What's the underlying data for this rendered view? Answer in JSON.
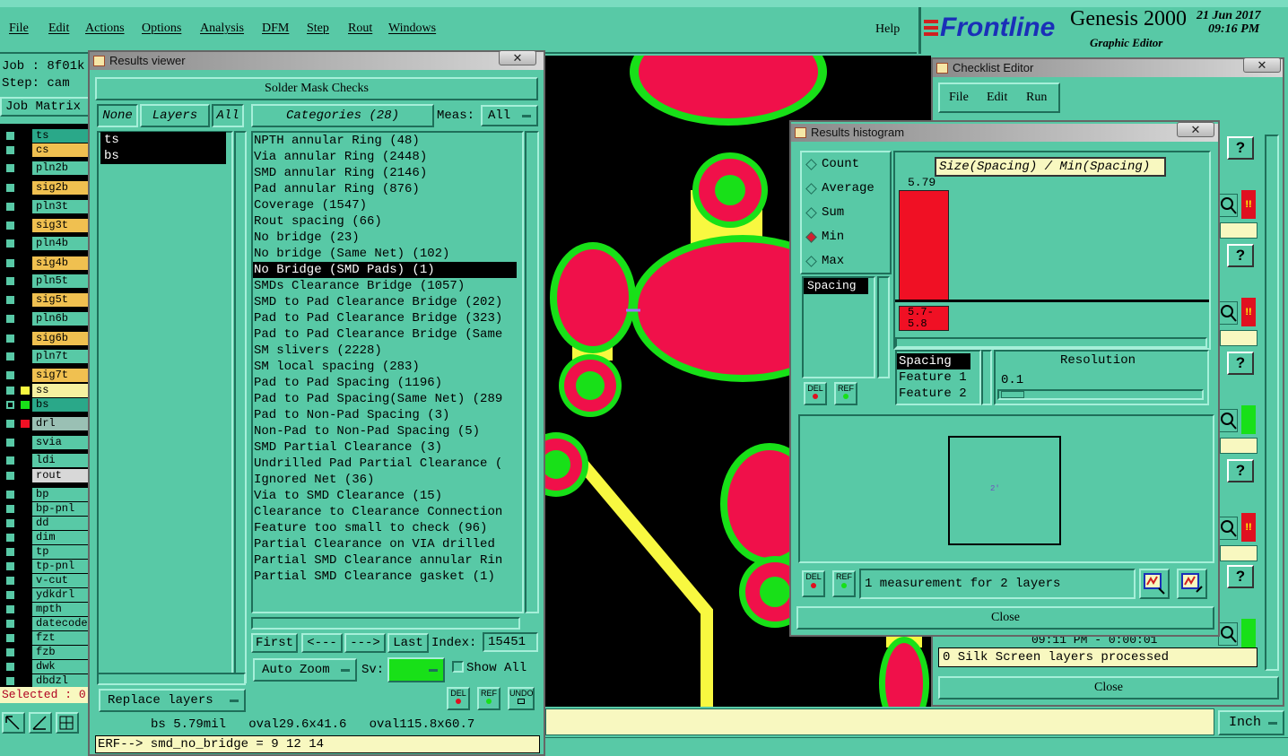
{
  "menu": [
    "File",
    "Edit",
    "Actions",
    "Options",
    "Analysis",
    "DFM",
    "Step",
    "Rout",
    "Windows"
  ],
  "help": "Help",
  "brand": {
    "logo": "Frontline",
    "product": "Genesis 2000",
    "subtitle": "Graphic Editor",
    "date": "21 Jun 2017",
    "time": "09:16 PM"
  },
  "job": {
    "job_label": "Job : 8f01k",
    "step_label": "Step: cam",
    "matrix": "Job Matrix",
    "selected": "Selected : 0"
  },
  "layers": [
    {
      "name": "ts",
      "color": "#2aa889"
    },
    {
      "name": "cs",
      "color": "#f0c050"
    },
    {
      "name": "pln2b",
      "color": "#58c9a6"
    },
    {
      "name": "sig2b",
      "color": "#f0c050"
    },
    {
      "name": "pln3t",
      "color": "#58c9a6"
    },
    {
      "name": "sig3t",
      "color": "#f0c050"
    },
    {
      "name": "pln4b",
      "color": "#58c9a6"
    },
    {
      "name": "sig4b",
      "color": "#f0c050"
    },
    {
      "name": "pln5t",
      "color": "#58c9a6"
    },
    {
      "name": "sig5t",
      "color": "#f0c050"
    },
    {
      "name": "pln6b",
      "color": "#58c9a6"
    },
    {
      "name": "sig6b",
      "color": "#f0c050"
    },
    {
      "name": "pln7t",
      "color": "#58c9a6"
    },
    {
      "name": "sig7t",
      "color": "#f0c050"
    },
    {
      "name": "ss",
      "color": "#f5f0a0"
    },
    {
      "name": "bs",
      "color": "#2aa889"
    },
    {
      "name": "drl",
      "color": "#9ac0b4"
    },
    {
      "name": "svia",
      "color": "#58c9a6"
    },
    {
      "name": "ldi",
      "color": "#58c9a6"
    },
    {
      "name": "rout",
      "color": "#d8d8d8"
    },
    {
      "name": "bp",
      "color": "#58c9a6"
    },
    {
      "name": "bp-pnl",
      "color": "#58c9a6"
    },
    {
      "name": "dd",
      "color": "#58c9a6"
    },
    {
      "name": "dim",
      "color": "#58c9a6"
    },
    {
      "name": "tp",
      "color": "#58c9a6"
    },
    {
      "name": "tp-pnl",
      "color": "#58c9a6"
    },
    {
      "name": "v-cut",
      "color": "#58c9a6"
    },
    {
      "name": "ydkdrl",
      "color": "#58c9a6"
    },
    {
      "name": "mpth",
      "color": "#58c9a6"
    },
    {
      "name": "datecode-",
      "color": "#58c9a6"
    },
    {
      "name": "fzt",
      "color": "#58c9a6"
    },
    {
      "name": "fzb",
      "color": "#58c9a6"
    },
    {
      "name": "dwk",
      "color": "#58c9a6"
    },
    {
      "name": "dbdzl",
      "color": "#58c9a6"
    }
  ],
  "results_viewer": {
    "title": "Results viewer",
    "close": "✕",
    "heading": "Solder Mask Checks",
    "none": "None",
    "layers": "Layers",
    "all": "All",
    "categories": "Categories (28)",
    "meas_label": "Meas:",
    "meas_value": "All",
    "layer_list": [
      "ts",
      "bs"
    ],
    "items": [
      "NPTH annular Ring (48)",
      "Via annular Ring (2448)",
      "SMD annular Ring (2146)",
      "Pad annular Ring (876)",
      "Coverage (1547)",
      "Rout spacing (66)",
      "No bridge (23)",
      "No bridge (Same Net) (102)",
      "No Bridge (SMD Pads) (1)",
      "SMDs Clearance Bridge (1057)",
      "SMD to Pad Clearance Bridge (202)",
      "Pad to Pad Clearance Bridge (323)",
      "Pad to Pad Clearance Bridge (Same",
      "SM slivers (2228)",
      "SM local spacing (283)",
      "Pad to Pad Spacing (1196)",
      "Pad to Pad Spacing(Same Net) (289",
      "Pad to Non-Pad Spacing (3)",
      "Non-Pad to Non-Pad Spacing (5)",
      "SMD Partial Clearance (3)",
      "Undrilled Pad Partial Clearance (",
      "Ignored Net (36)",
      "Via to SMD Clearance (15)",
      "Clearance to Clearance Connection",
      "Feature too small to check (96)",
      "Partial Clearance on VIA drilled",
      "Partial SMD Clearance annular Rin",
      "Partial SMD Clearance gasket (1)"
    ],
    "first": "First",
    "prev": "<---",
    "next": "--->",
    "last": "Last",
    "index_label": "Index:",
    "index_value": "15451",
    "auto_zoom": "Auto Zoom",
    "sv_label": "Sv:",
    "show_all": "Show All",
    "replace_layers": "Replace layers",
    "del": "DEL",
    "ref": "REF",
    "undo": "UNDO",
    "status": "bs 5.79mil   oval29.6x41.6   oval115.8x60.7",
    "erf": "ERF--> smd_no_bridge = 9 12 14"
  },
  "histogram": {
    "title": "Results histogram",
    "close": "✕",
    "modes": [
      "Count",
      "Average",
      "Sum",
      "Min",
      "Max"
    ],
    "selected_mode": "Min",
    "measure_list": [
      "Spacing"
    ],
    "chart_title": "Size(Spacing) / Min(Spacing)",
    "bar_value": "5.79",
    "bar_label": "5.7-\n5.8",
    "attrs": [
      "Spacing",
      "Feature 1",
      "Feature 2"
    ],
    "resolution_label": "Resolution",
    "resolution_value": "0.1",
    "del": "DEL",
    "ref": "REF",
    "marker": "2′",
    "summary": "1 measurement for 2 layers",
    "close_btn": "Close"
  },
  "checklist": {
    "title": "Checklist Editor",
    "close": "✕",
    "menu": [
      "File",
      "Edit",
      "Run"
    ],
    "time_row": "09:11 PM - 0:00:01",
    "status": "0 Silk Screen layers processed",
    "close_btn": "Close",
    "q": "?",
    "warn": "!!"
  },
  "units": "Inch",
  "colors": {
    "pad": "#f0104a",
    "outline": "#18e018",
    "trace": "#f8f840",
    "bg": "#000000",
    "ui": "#58c9a6"
  }
}
